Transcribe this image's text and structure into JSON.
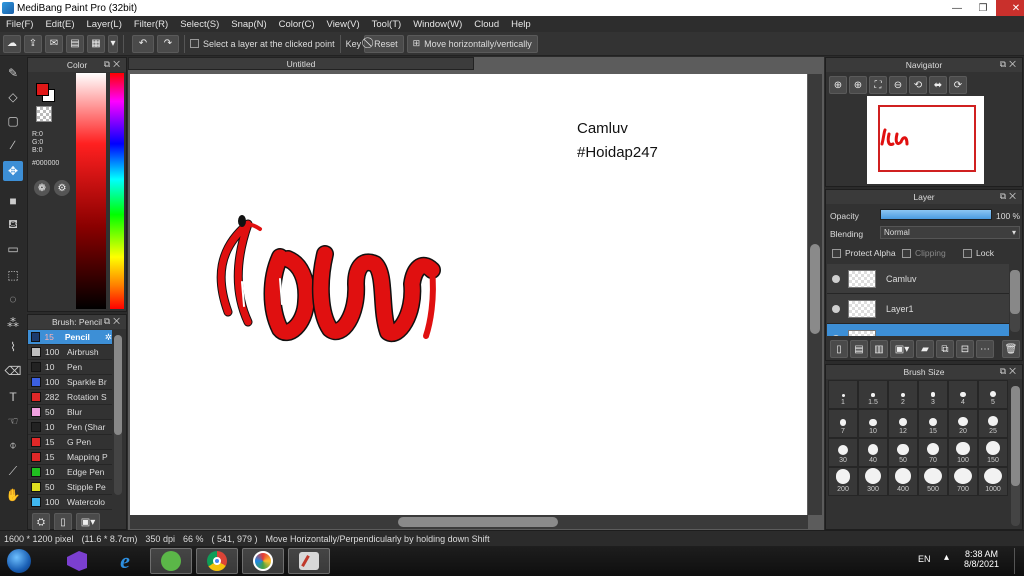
{
  "window": {
    "title": "MediBang Paint Pro (32bit)",
    "min": "—",
    "max": "❐",
    "close": "✕"
  },
  "menu": [
    "File(F)",
    "Edit(E)",
    "Layer(L)",
    "Filter(R)",
    "Select(S)",
    "Snap(N)",
    "Color(C)",
    "View(V)",
    "Tool(T)",
    "Window(W)",
    "Cloud",
    "Help"
  ],
  "toolbar": {
    "select_layer_label": "Select a layer at the clicked point",
    "key_label": "Key",
    "reset_label": "Reset",
    "move_label": "Move horizontally/vertically"
  },
  "color_panel": {
    "title": "Color",
    "r": "R:0",
    "g": "G:0",
    "b": "B:0",
    "hex": "#000000",
    "fg_color": "#e01818",
    "bg_color": "#ffffff"
  },
  "brush_panel": {
    "title": "Brush: Pencil",
    "items": [
      {
        "size": "15",
        "name": "Pencil",
        "color": "#1b3b6e",
        "selected": true
      },
      {
        "size": "100",
        "name": "Airbrush",
        "color": "#bfbfbf"
      },
      {
        "size": "10",
        "name": "Pen",
        "color": "#222222"
      },
      {
        "size": "100",
        "name": "Sparkle Br",
        "color": "#3b5fe0"
      },
      {
        "size": "282",
        "name": "Rotation S",
        "color": "#e02828"
      },
      {
        "size": "50",
        "name": "Blur",
        "color": "#f0a0e0"
      },
      {
        "size": "10",
        "name": "Pen (Shar",
        "color": "#222222"
      },
      {
        "size": "15",
        "name": "G Pen",
        "color": "#e02828"
      },
      {
        "size": "15",
        "name": "Mapping P",
        "color": "#e02828"
      },
      {
        "size": "10",
        "name": "Edge Pen",
        "color": "#20c020"
      },
      {
        "size": "50",
        "name": "Stipple Pe",
        "color": "#e0e020"
      },
      {
        "size": "100",
        "name": "Watercolo",
        "color": "#40b8f0"
      }
    ]
  },
  "canvas": {
    "tab_title": "Untitled",
    "text_line1": "Camluv",
    "text_line2": "#Hoidap247"
  },
  "navigator": {
    "title": "Navigator"
  },
  "layer_panel": {
    "title": "Layer",
    "opacity_label": "Opacity",
    "opacity_value": "100 %",
    "opacity_level": 1.0,
    "blending_label": "Blending",
    "blending_value": "Normal",
    "protect_alpha": "Protect Alpha",
    "clipping": "Clipping",
    "lock": "Lock",
    "layers": [
      {
        "name": "Camluv"
      },
      {
        "name": "Layer1"
      }
    ]
  },
  "brush_size_panel": {
    "title": "Brush Size",
    "sizes": [
      "1",
      "1.5",
      "2",
      "3",
      "4",
      "5",
      "7",
      "10",
      "12",
      "15",
      "20",
      "25",
      "30",
      "40",
      "50",
      "70",
      "100",
      "150",
      "200",
      "300",
      "400",
      "500",
      "700",
      "1000"
    ]
  },
  "statusbar": {
    "dimensions": "1600 * 1200 pixel",
    "physical": "(11.6 * 8.7cm)",
    "dpi": "350 dpi",
    "zoom": "66 %",
    "coords": "( 541, 979 )",
    "hint": "Move Horizontally/Perpendicularly by holding down Shift"
  },
  "taskbar": {
    "lang": "EN",
    "time": "8:38 AM",
    "date": "8/8/2021"
  }
}
